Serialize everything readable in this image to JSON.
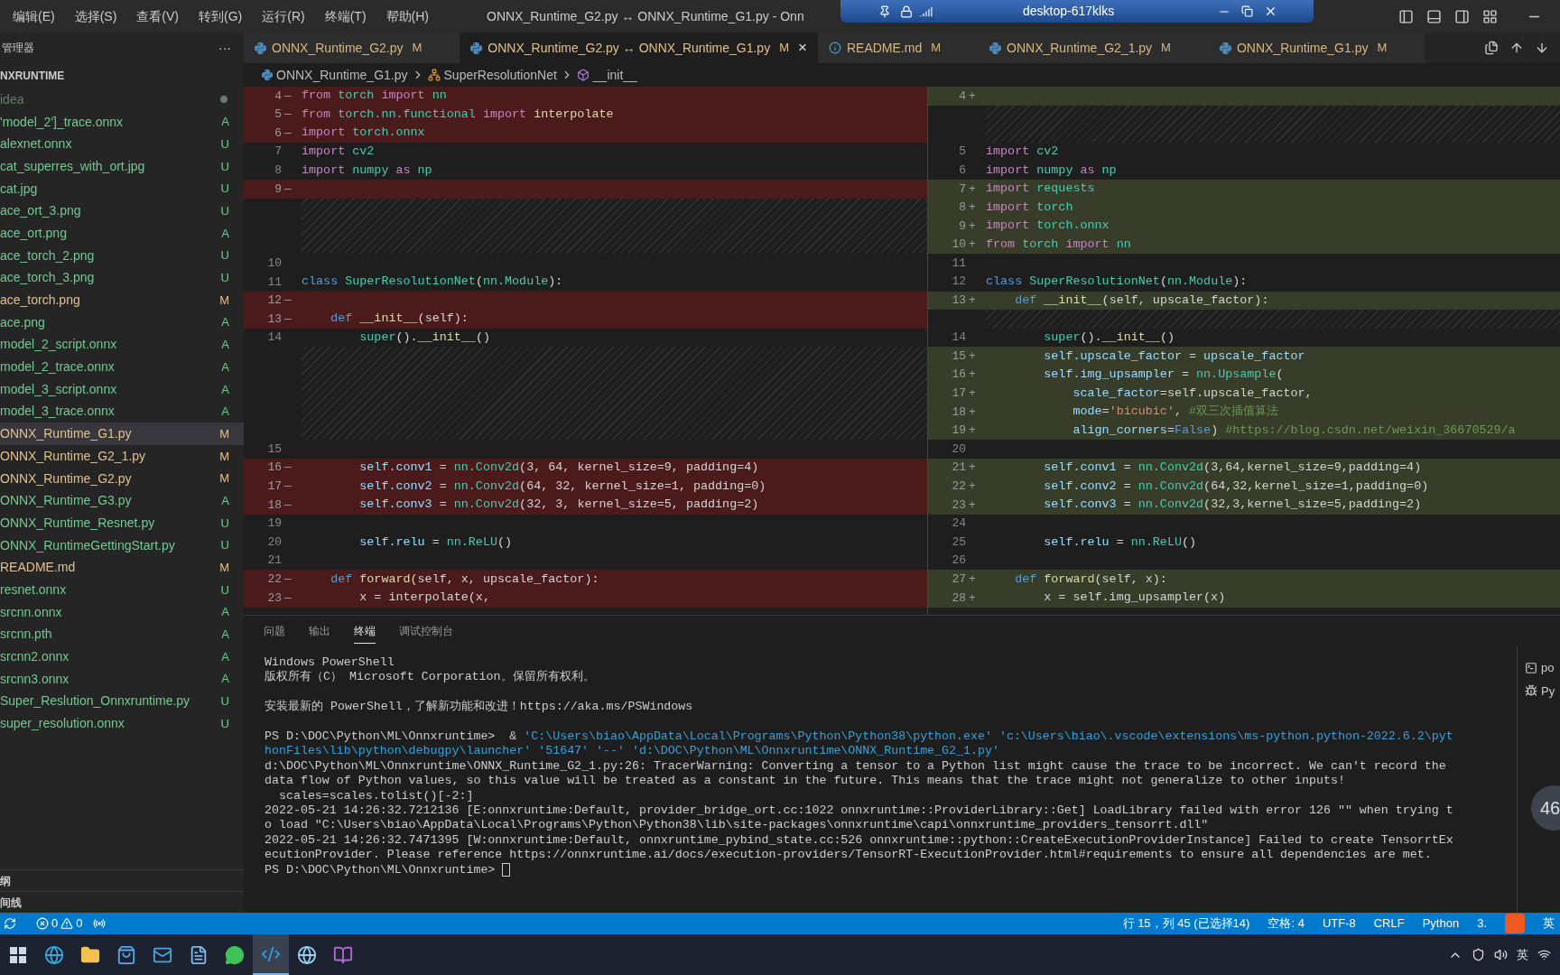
{
  "titlebar": {
    "menus": [
      "编辑(E)",
      "选择(S)",
      "查看(V)",
      "转到(G)",
      "运行(R)",
      "终端(T)",
      "帮助(H)"
    ],
    "title": "ONNX_Runtime_G2.py ↔ ONNX_Runtime_G1.py - Onn"
  },
  "remote_bar": {
    "host": "desktop-617klks"
  },
  "sidebar": {
    "title": "管理器",
    "more": "···",
    "folder": "NXRUNTIME",
    "items": [
      {
        "name": "idea",
        "color": "#6b7b6b",
        "selected": false
      },
      {
        "name": "'model_2']_trace.onnx",
        "status": "A",
        "color": "#73c991",
        "selected": false
      },
      {
        "name": "alexnet.onnx",
        "status": "U",
        "color": "#73c991",
        "selected": false
      },
      {
        "name": "cat_superres_with_ort.jpg",
        "status": "U",
        "color": "#73c991",
        "selected": false
      },
      {
        "name": "cat.jpg",
        "status": "U",
        "color": "#73c991",
        "selected": false
      },
      {
        "name": "ace_ort_3.png",
        "status": "U",
        "color": "#73c991",
        "selected": false
      },
      {
        "name": "ace_ort.png",
        "status": "A",
        "color": "#73c991",
        "selected": false
      },
      {
        "name": "ace_torch_2.png",
        "status": "U",
        "color": "#73c991",
        "selected": false
      },
      {
        "name": "ace_torch_3.png",
        "status": "U",
        "color": "#73c991",
        "selected": false
      },
      {
        "name": "ace_torch.png",
        "status": "M",
        "color": "#e2c08d",
        "selected": false
      },
      {
        "name": "ace.png",
        "status": "A",
        "color": "#73c991",
        "selected": false
      },
      {
        "name": "model_2_script.onnx",
        "status": "A",
        "color": "#73c991",
        "selected": false
      },
      {
        "name": "model_2_trace.onnx",
        "status": "A",
        "color": "#73c991",
        "selected": false
      },
      {
        "name": "model_3_script.onnx",
        "status": "A",
        "color": "#73c991",
        "selected": false
      },
      {
        "name": "model_3_trace.onnx",
        "status": "A",
        "color": "#73c991",
        "selected": false
      },
      {
        "name": "ONNX_Runtime_G1.py",
        "status": "M",
        "color": "#e2c08d",
        "selected": true
      },
      {
        "name": "ONNX_Runtime_G2_1.py",
        "status": "M",
        "color": "#e2c08d",
        "selected": false
      },
      {
        "name": "ONNX_Runtime_G2.py",
        "status": "M",
        "color": "#e2c08d",
        "selected": false
      },
      {
        "name": "ONNX_Runtime_G3.py",
        "status": "A",
        "color": "#73c991",
        "selected": false
      },
      {
        "name": "ONNX_Runtime_Resnet.py",
        "status": "U",
        "color": "#73c991",
        "selected": false
      },
      {
        "name": "ONNX_RuntimeGettingStart.py",
        "status": "U",
        "color": "#73c991",
        "selected": false
      },
      {
        "name": "README.md",
        "status": "M",
        "color": "#e2c08d",
        "selected": false
      },
      {
        "name": "resnet.onnx",
        "status": "U",
        "color": "#73c991",
        "selected": false
      },
      {
        "name": "srcnn.onnx",
        "status": "A",
        "color": "#73c991",
        "selected": false
      },
      {
        "name": "srcnn.pth",
        "status": "A",
        "color": "#73c991",
        "selected": false
      },
      {
        "name": "srcnn2.onnx",
        "status": "A",
        "color": "#73c991",
        "selected": false
      },
      {
        "name": "srcnn3.onnx",
        "status": "A",
        "color": "#73c991",
        "selected": false
      },
      {
        "name": "Super_Reslution_Onnxruntime.py",
        "status": "U",
        "color": "#73c991",
        "selected": false
      },
      {
        "name": "super_resolution.onnx",
        "status": "U",
        "color": "#73c991",
        "selected": false
      }
    ],
    "sections": [
      "纲",
      "间线"
    ]
  },
  "tabs": [
    {
      "label": "ONNX_Runtime_G2.py",
      "status": "M",
      "kind": "python",
      "selected": false
    },
    {
      "label": "ONNX_Runtime_G2.py ↔ ONNX_Runtime_G1.py",
      "status": "M",
      "kind": "python",
      "selected": true,
      "close": "×"
    },
    {
      "label": "README.md",
      "status": "M",
      "kind": "info",
      "selected": false
    },
    {
      "label": "ONNX_Runtime_G2_1.py",
      "status": "M",
      "kind": "python",
      "selected": false
    },
    {
      "label": "ONNX_Runtime_G1.py",
      "status": "M",
      "kind": "python",
      "selected": false
    }
  ],
  "breadcrumb": [
    {
      "label": "ONNX_Runtime_G1.py",
      "kind": "file"
    },
    {
      "label": "SuperResolutionNet",
      "kind": "class"
    },
    {
      "label": "__init__",
      "kind": "method"
    }
  ],
  "diff": {
    "left": [
      {
        "num": "4",
        "marker": "—",
        "kind": "removed",
        "code": [
          {
            "text": "from ",
            "kind": "ctrl"
          },
          {
            "text": "torch ",
            "kind": "mod"
          },
          {
            "text": "import ",
            "kind": "ctrl"
          },
          {
            "text": "nn",
            "kind": "mod"
          }
        ]
      },
      {
        "num": "5",
        "marker": "—",
        "kind": "removed",
        "code": [
          {
            "text": "from ",
            "kind": "ctrl"
          },
          {
            "text": "torch.nn.functional ",
            "kind": "mod"
          },
          {
            "text": "import ",
            "kind": "ctrl"
          },
          {
            "text": "interpolate",
            "kind": "fn"
          }
        ]
      },
      {
        "num": "6",
        "marker": "—",
        "kind": "removed",
        "code": [
          {
            "text": "import ",
            "kind": "ctrl"
          },
          {
            "text": "torch.onnx",
            "kind": "mod"
          }
        ]
      },
      {
        "num": "7",
        "kind": "none",
        "code": [
          {
            "text": "import ",
            "kind": "ctrl"
          },
          {
            "text": "cv2",
            "kind": "mod"
          }
        ]
      },
      {
        "num": "8",
        "kind": "none",
        "code": [
          {
            "text": "import ",
            "kind": "ctrl"
          },
          {
            "text": "numpy ",
            "kind": "mod"
          },
          {
            "text": "as ",
            "kind": "ctrl"
          },
          {
            "text": "np",
            "kind": "mod"
          }
        ]
      },
      {
        "num": "9",
        "marker": "—",
        "kind": "removed"
      },
      {
        "kind": "filler"
      },
      {
        "kind": "filler"
      },
      {
        "kind": "filler"
      },
      {
        "num": "10",
        "kind": "none"
      },
      {
        "num": "11",
        "kind": "none",
        "code": [
          {
            "text": "class ",
            "kind": "kw"
          },
          {
            "text": "SuperResolutionNet",
            "kind": "mod"
          },
          {
            "text": "(",
            "kind": "txt"
          },
          {
            "text": "nn.Module",
            "kind": "mod"
          },
          {
            "text": "):",
            "kind": "txt"
          }
        ]
      },
      {
        "num": "12",
        "marker": "—",
        "kind": "removed"
      },
      {
        "num": "13",
        "marker": "—",
        "kind": "removed",
        "code": [
          {
            "text": "    def ",
            "kind": "kw"
          },
          {
            "text": "__init__",
            "kind": "fn"
          },
          {
            "text": "(self):",
            "kind": "txt"
          }
        ]
      },
      {
        "num": "14",
        "kind": "none",
        "code": [
          {
            "text": "        super",
            "kind": "mod"
          },
          {
            "text": "().",
            "kind": "txt"
          },
          {
            "text": "__init__",
            "kind": "fn"
          },
          {
            "text": "()",
            "kind": "txt"
          }
        ]
      },
      {
        "kind": "filler"
      },
      {
        "kind": "filler"
      },
      {
        "kind": "filler"
      },
      {
        "kind": "filler"
      },
      {
        "kind": "filler"
      },
      {
        "num": "15",
        "kind": "none"
      },
      {
        "num": "16",
        "marker": "—",
        "kind": "removed",
        "code": [
          {
            "text": "        self.conv1",
            "kind": "var"
          },
          {
            "text": " = ",
            "kind": "txt"
          },
          {
            "text": "nn.Conv2d",
            "kind": "mod"
          },
          {
            "text": "(3, 64, kernel_size=9, padding=4)",
            "kind": "txt"
          }
        ]
      },
      {
        "num": "17",
        "marker": "—",
        "kind": "removed",
        "code": [
          {
            "text": "        self.conv2",
            "kind": "var"
          },
          {
            "text": " = ",
            "kind": "txt"
          },
          {
            "text": "nn.Conv2d",
            "kind": "mod"
          },
          {
            "text": "(64, 32, kernel_size=1, padding=0)",
            "kind": "txt"
          }
        ]
      },
      {
        "num": "18",
        "marker": "—",
        "kind": "removed",
        "code": [
          {
            "text": "        self.conv3",
            "kind": "var"
          },
          {
            "text": " = ",
            "kind": "txt"
          },
          {
            "text": "nn.Conv2d",
            "kind": "mod"
          },
          {
            "text": "(32, 3, kernel_size=5, padding=2)",
            "kind": "txt"
          }
        ]
      },
      {
        "num": "19",
        "kind": "none"
      },
      {
        "num": "20",
        "kind": "none",
        "code": [
          {
            "text": "        self.relu",
            "kind": "var"
          },
          {
            "text": " = ",
            "kind": "txt"
          },
          {
            "text": "nn.ReLU",
            "kind": "mod"
          },
          {
            "text": "()",
            "kind": "txt"
          }
        ]
      },
      {
        "num": "21",
        "kind": "none"
      },
      {
        "num": "22",
        "marker": "—",
        "kind": "removed",
        "code": [
          {
            "text": "    def ",
            "kind": "kw"
          },
          {
            "text": "forward",
            "kind": "fn"
          },
          {
            "text": "(self, x, upscale_factor):",
            "kind": "txt"
          }
        ]
      },
      {
        "num": "23",
        "marker": "—",
        "kind": "removed",
        "code": [
          {
            "text": "        x = interpolate(x,",
            "kind": "txt"
          }
        ]
      }
    ],
    "right": [
      {
        "num": "4",
        "marker": "+",
        "kind": "added"
      },
      {
        "kind": "filler"
      },
      {
        "kind": "filler"
      },
      {
        "num": "5",
        "kind": "none",
        "code": [
          {
            "text": "import ",
            "kind": "ctrl"
          },
          {
            "text": "cv2",
            "kind": "mod"
          }
        ]
      },
      {
        "num": "6",
        "kind": "none",
        "code": [
          {
            "text": "import ",
            "kind": "ctrl"
          },
          {
            "text": "numpy ",
            "kind": "mod"
          },
          {
            "text": "as ",
            "kind": "ctrl"
          },
          {
            "text": "np",
            "kind": "mod"
          }
        ]
      },
      {
        "num": "7",
        "marker": "+",
        "kind": "added",
        "code": [
          {
            "text": "import ",
            "kind": "ctrl"
          },
          {
            "text": "requests",
            "kind": "mod"
          }
        ]
      },
      {
        "num": "8",
        "marker": "+",
        "kind": "added",
        "code": [
          {
            "text": "import ",
            "kind": "ctrl"
          },
          {
            "text": "torch",
            "kind": "mod"
          }
        ]
      },
      {
        "num": "9",
        "marker": "+",
        "kind": "added",
        "code": [
          {
            "text": "import ",
            "kind": "ctrl"
          },
          {
            "text": "torch.onnx",
            "kind": "mod"
          }
        ]
      },
      {
        "num": "10",
        "marker": "+",
        "kind": "added",
        "code": [
          {
            "text": "from ",
            "kind": "ctrl"
          },
          {
            "text": "torch ",
            "kind": "mod"
          },
          {
            "text": "import ",
            "kind": "ctrl"
          },
          {
            "text": "nn",
            "kind": "mod"
          }
        ]
      },
      {
        "num": "11",
        "kind": "none"
      },
      {
        "num": "12",
        "kind": "none",
        "code": [
          {
            "text": "class ",
            "kind": "kw"
          },
          {
            "text": "SuperResolutionNet",
            "kind": "mod"
          },
          {
            "text": "(",
            "kind": "txt"
          },
          {
            "text": "nn.Module",
            "kind": "mod"
          },
          {
            "text": "):",
            "kind": "txt"
          }
        ]
      },
      {
        "num": "13",
        "marker": "+",
        "kind": "added",
        "code": [
          {
            "text": "    def ",
            "kind": "kw"
          },
          {
            "text": "__init__",
            "kind": "fn"
          },
          {
            "text": "(self, upscale_factor):",
            "kind": "txt"
          }
        ]
      },
      {
        "kind": "filler"
      },
      {
        "num": "14",
        "kind": "none",
        "code": [
          {
            "text": "        super",
            "kind": "mod"
          },
          {
            "text": "().",
            "kind": "txt"
          },
          {
            "text": "__init__",
            "kind": "fn"
          },
          {
            "text": "()",
            "kind": "txt"
          }
        ]
      },
      {
        "num": "15",
        "marker": "+",
        "kind": "added",
        "code": [
          {
            "text": "        self.upscale_factor",
            "kind": "var"
          },
          {
            "text": " = ",
            "kind": "txt"
          },
          {
            "text": "upscale_factor",
            "kind": "var"
          }
        ]
      },
      {
        "num": "16",
        "marker": "+",
        "kind": "added",
        "code": [
          {
            "text": "        self.img_upsampler",
            "kind": "var"
          },
          {
            "text": " = ",
            "kind": "txt"
          },
          {
            "text": "nn.Upsample",
            "kind": "mod"
          },
          {
            "text": "(",
            "kind": "txt"
          }
        ]
      },
      {
        "num": "17",
        "marker": "+",
        "kind": "added",
        "code": [
          {
            "text": "            scale_factor",
            "kind": "var"
          },
          {
            "text": "=self.upscale_factor,",
            "kind": "txt"
          }
        ]
      },
      {
        "num": "18",
        "marker": "+",
        "kind": "added",
        "code": [
          {
            "text": "            mode",
            "kind": "var"
          },
          {
            "text": "=",
            "kind": "txt"
          },
          {
            "text": "'bicubic'",
            "kind": "str"
          },
          {
            "text": ", ",
            "kind": "txt"
          },
          {
            "text": "#双三次插值算法",
            "kind": "com"
          }
        ]
      },
      {
        "num": "19",
        "marker": "+",
        "kind": "added",
        "code": [
          {
            "text": "            align_corners",
            "kind": "var"
          },
          {
            "text": "=",
            "kind": "txt"
          },
          {
            "text": "False",
            "kind": "kw"
          },
          {
            "text": ") ",
            "kind": "txt"
          },
          {
            "text": "#https://blog.csdn.net/weixin_36670529/a",
            "kind": "com"
          }
        ]
      },
      {
        "num": "20",
        "kind": "none"
      },
      {
        "num": "21",
        "marker": "+",
        "kind": "added",
        "code": [
          {
            "text": "        self.conv1",
            "kind": "var"
          },
          {
            "text": " = ",
            "kind": "txt"
          },
          {
            "text": "nn.Conv2d",
            "kind": "mod"
          },
          {
            "text": "(3,64,kernel_size=9,padding=4)",
            "kind": "txt"
          }
        ]
      },
      {
        "num": "22",
        "marker": "+",
        "kind": "added",
        "code": [
          {
            "text": "        self.conv2",
            "kind": "var"
          },
          {
            "text": " = ",
            "kind": "txt"
          },
          {
            "text": "nn.Conv2d",
            "kind": "mod"
          },
          {
            "text": "(64,32,kernel_size=1,padding=0)",
            "kind": "txt"
          }
        ]
      },
      {
        "num": "23",
        "marker": "+",
        "kind": "added",
        "code": [
          {
            "text": "        self.conv3",
            "kind": "var"
          },
          {
            "text": " = ",
            "kind": "txt"
          },
          {
            "text": "nn.Conv2d",
            "kind": "mod"
          },
          {
            "text": "(32,3,kernel_size=5,padding=2)",
            "kind": "txt"
          }
        ]
      },
      {
        "num": "24",
        "kind": "none"
      },
      {
        "num": "25",
        "kind": "none",
        "code": [
          {
            "text": "        self.relu",
            "kind": "var"
          },
          {
            "text": " = ",
            "kind": "txt"
          },
          {
            "text": "nn.ReLU",
            "kind": "mod"
          },
          {
            "text": "()",
            "kind": "txt"
          }
        ]
      },
      {
        "num": "26",
        "kind": "none"
      },
      {
        "num": "27",
        "marker": "+",
        "kind": "added",
        "code": [
          {
            "text": "    def ",
            "kind": "kw"
          },
          {
            "text": "forward",
            "kind": "fn"
          },
          {
            "text": "(self, x):",
            "kind": "txt"
          }
        ]
      },
      {
        "num": "28",
        "marker": "+",
        "kind": "added",
        "code": [
          {
            "text": "        x = self.img_upsampler(x)",
            "kind": "txt"
          }
        ]
      }
    ]
  },
  "panel": {
    "tabs": [
      {
        "label": "问题",
        "selected": false
      },
      {
        "label": "输出",
        "selected": false
      },
      {
        "label": "终端",
        "selected": true
      },
      {
        "label": "调试控制台",
        "selected": false
      }
    ],
    "terminal": [
      {
        "segments": [
          {
            "text": "Windows PowerShell",
            "kind": "txt"
          }
        ]
      },
      {
        "segments": [
          {
            "text": "版权所有（C） Microsoft Corporation。保留所有权利。",
            "kind": "txt"
          }
        ]
      },
      {
        "spaced": true,
        "segments": [
          {
            "text": "安装最新的 PowerShell，了解新功能和改进！https://aka.ms/PSWindows",
            "kind": "txt"
          }
        ]
      },
      {
        "spaced": true,
        "segments": [
          {
            "text": "PS D:\\DOC\\Python\\ML\\Onnxruntime>  & ",
            "kind": "txt"
          },
          {
            "text": "'C:\\Users\\biao\\AppData\\Local\\Programs\\Python\\Python38\\python.exe' 'c:\\Users\\biao\\.vscode\\extensions\\ms-python.python-2022.6.2\\pyt",
            "kind": "str"
          }
        ]
      },
      {
        "segments": [
          {
            "text": "honFiles\\lib\\python\\debugpy\\launcher' '51647' '--' 'd:\\DOC\\Python\\ML\\Onnxruntime\\ONNX_Runtime_G2_1.py'",
            "kind": "str"
          }
        ]
      },
      {
        "segments": [
          {
            "text": "d:\\DOC\\Python\\ML\\Onnxruntime\\ONNX_Runtime_G2_1.py:26: TracerWarning: Converting a tensor to a Python list might cause the trace to be incorrect. We can't record the",
            "kind": "txt"
          }
        ]
      },
      {
        "segments": [
          {
            "text": "data flow of Python values, so this value will be treated as a constant in the future. This means that the trace might not generalize to other inputs!",
            "kind": "txt"
          }
        ]
      },
      {
        "segments": [
          {
            "text": "  scales=scales.tolist()[-2:]",
            "kind": "txt"
          }
        ]
      },
      {
        "segments": [
          {
            "text": "2022-05-21 14:26:32.7212136 [E:onnxruntime:Default, provider_bridge_ort.cc:1022 onnxruntime::ProviderLibrary::Get] LoadLibrary failed with error 126 \"\" when trying t",
            "kind": "txt"
          }
        ]
      },
      {
        "segments": [
          {
            "text": "o load \"C:\\Users\\biao\\AppData\\Local\\Programs\\Python\\Python38\\lib\\site-packages\\onnxruntime\\capi\\onnxruntime_providers_tensorrt.dll\"",
            "kind": "txt"
          }
        ]
      },
      {
        "segments": [
          {
            "text": "2022-05-21 14:26:32.7471395 [W:onnxruntime:Default, onnxruntime_pybind_state.cc:526 onnxruntime::python::CreateExecutionProviderInstance] Failed to create TensorrtEx",
            "kind": "txt"
          }
        ]
      },
      {
        "segments": [
          {
            "text": "ecutionProvider. Please reference https://onnxruntime.ai/docs/execution-providers/TensorRT-ExecutionProvider.html#requirements to ensure all dependencies are met.",
            "kind": "txt"
          }
        ]
      },
      {
        "prompt": true,
        "segments": [
          {
            "text": "PS D:\\DOC\\Python\\ML\\Onnxruntime> ",
            "kind": "txt"
          }
        ]
      }
    ],
    "instances": [
      {
        "label": "po",
        "kind": "shell"
      },
      {
        "label": "Py",
        "kind": "debug"
      }
    ]
  },
  "floating_badge": "46",
  "status_bar": {
    "errors": "0",
    "warnings": "0",
    "items": [
      "行 15，列 45 (已选择14)",
      "空格: 4",
      "UTF-8",
      "CRLF",
      "Python",
      "3."
    ],
    "ime": "英"
  },
  "taskbar": {
    "apps": [
      {
        "kind": "start",
        "selected": false
      },
      {
        "kind": "browser",
        "selected": false
      },
      {
        "kind": "folder",
        "selected": false
      },
      {
        "kind": "store",
        "selected": false
      },
      {
        "kind": "mail",
        "selected": false
      },
      {
        "kind": "notes",
        "selected": false
      },
      {
        "kind": "chat",
        "selected": false
      },
      {
        "kind": "code",
        "selected": true
      },
      {
        "kind": "globe",
        "selected": false
      },
      {
        "kind": "notebook",
        "selected": false
      }
    ],
    "ime": "英"
  }
}
